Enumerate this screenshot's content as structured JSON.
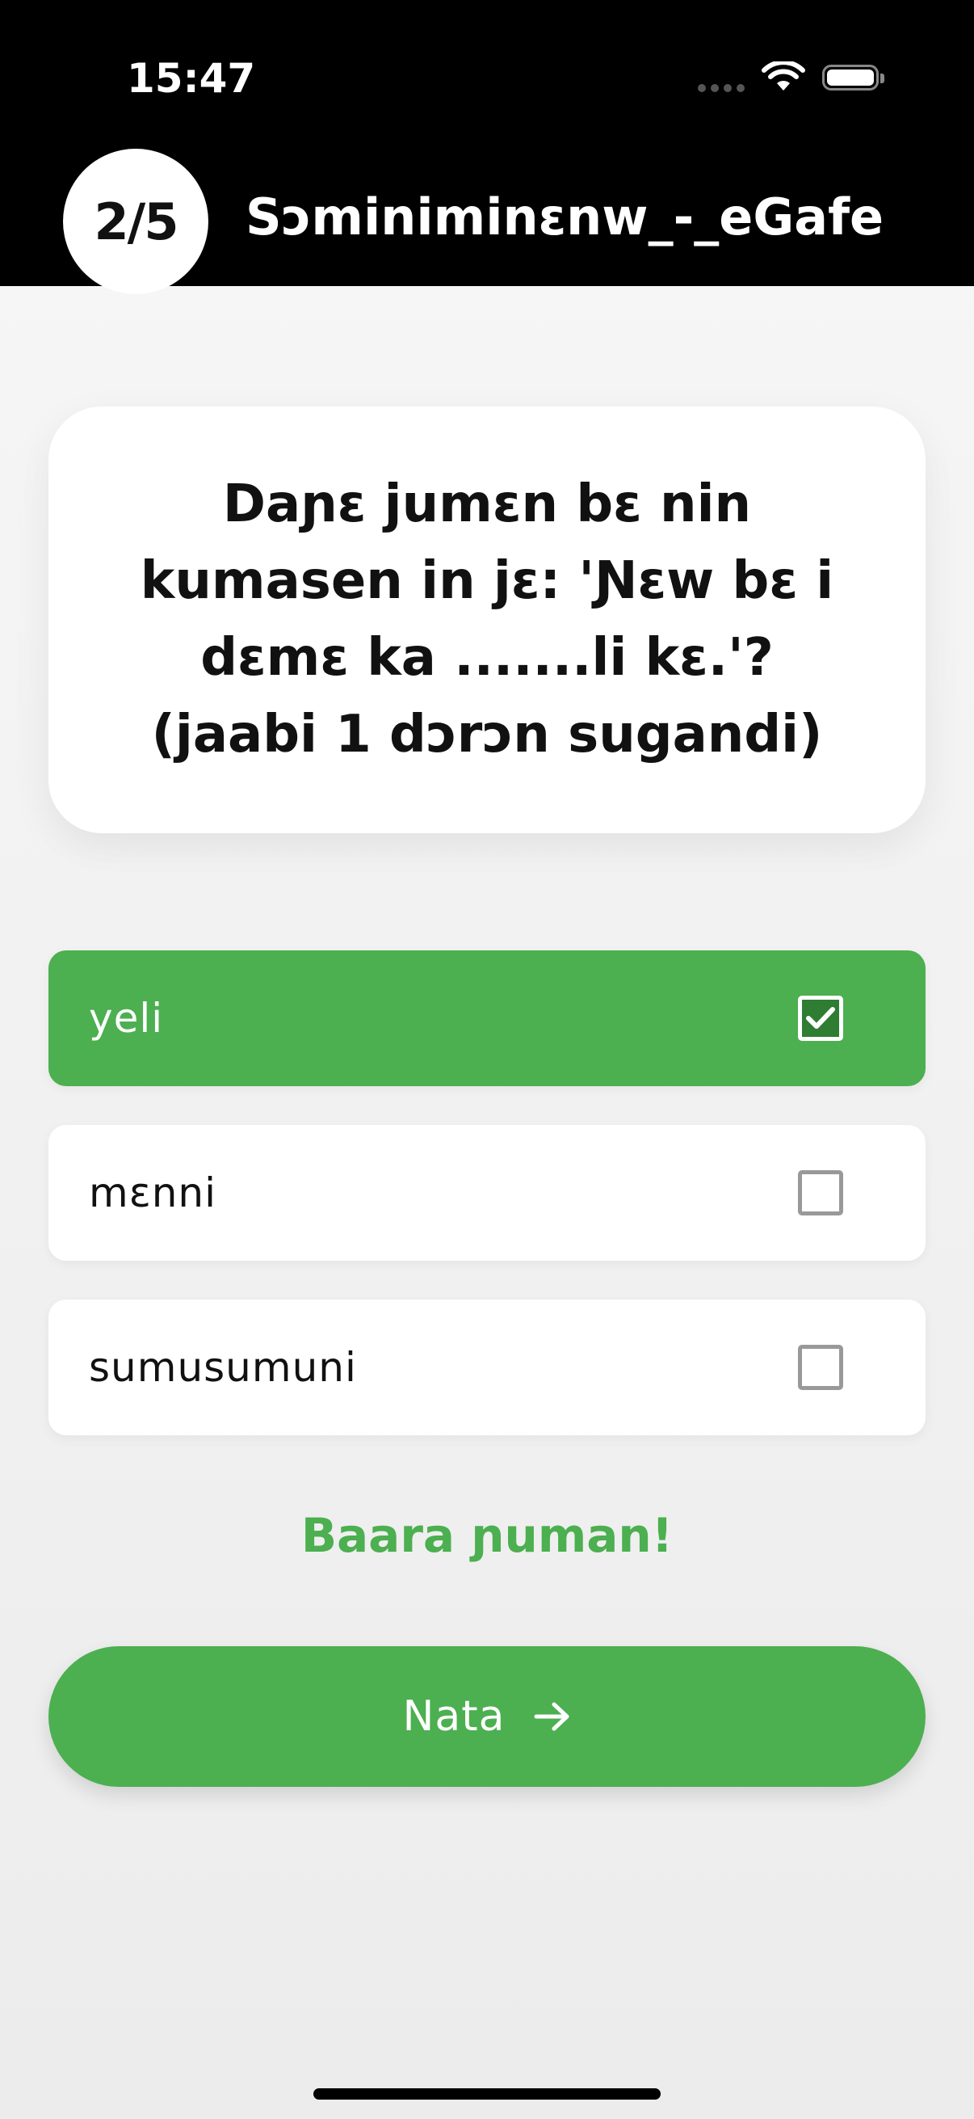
{
  "status_bar": {
    "time": "15:47",
    "icons": [
      "cellular-signal-icon",
      "wifi-icon",
      "battery-icon"
    ]
  },
  "header": {
    "progress": "2/5",
    "title": "Sɔminiminɛnw_-_eGafe"
  },
  "question": {
    "text": "Daɲɛ jumɛn bɛ nin kumasen in jɛ: 'Ɲɛw bɛ i dɛmɛ ka .......li kɛ.'? (jaabi 1 dɔrɔn sugandi)"
  },
  "options": [
    {
      "label": "yeli",
      "checked": true
    },
    {
      "label": "mɛnni",
      "checked": false
    },
    {
      "label": "sumusumuni",
      "checked": false
    }
  ],
  "feedback": {
    "text": "Baara ɲuman!"
  },
  "next_button": {
    "label": "Nata",
    "icon": "arrow-right-icon"
  },
  "colors": {
    "accent": "#4caf50",
    "checkbox_checked": "#2e7d32",
    "header_bg": "#000000"
  }
}
